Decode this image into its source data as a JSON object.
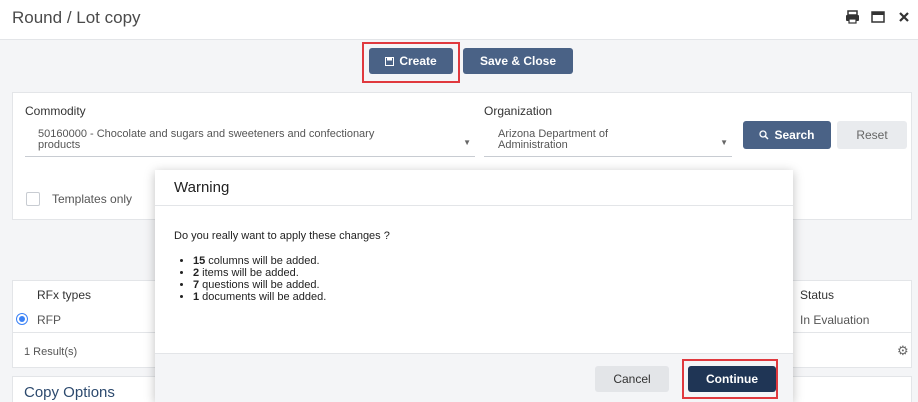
{
  "window": {
    "title": "Round / Lot copy",
    "icons": [
      "printer-icon",
      "maximize-icon",
      "close-icon"
    ]
  },
  "toolbar": {
    "create_label": "Create",
    "save_close_label": "Save & Close"
  },
  "filters": {
    "commodity_label": "Commodity",
    "commodity_value_line1": "50160000 - Chocolate and sugars and sweeteners and confectionary",
    "commodity_value_line2": "products",
    "organization_label": "Organization",
    "organization_value_line1": "Arizona Department of",
    "organization_value_line2": "Administration",
    "search_label": "Search",
    "reset_label": "Reset",
    "templates_only_label": "Templates only"
  },
  "table": {
    "headers": {
      "rfx_types": "RFx types",
      "status": "Status"
    },
    "rows": [
      {
        "rfx_type": "RFP",
        "status": "In Evaluation"
      }
    ],
    "results_label": "1 Result(s)"
  },
  "copy_options_title": "Copy Options",
  "modal": {
    "title": "Warning",
    "question": "Do you really want to apply these changes ?",
    "items": [
      {
        "count": "15",
        "text": " columns will be added."
      },
      {
        "count": "2",
        "text": " items will be added."
      },
      {
        "count": "7",
        "text": " questions will be added."
      },
      {
        "count": "1",
        "text": " documents will be added."
      }
    ],
    "cancel_label": "Cancel",
    "continue_label": "Continue"
  },
  "colors": {
    "primary_button": "#4a6286",
    "continue_button": "#1f3555",
    "highlight": "#e0393e"
  }
}
